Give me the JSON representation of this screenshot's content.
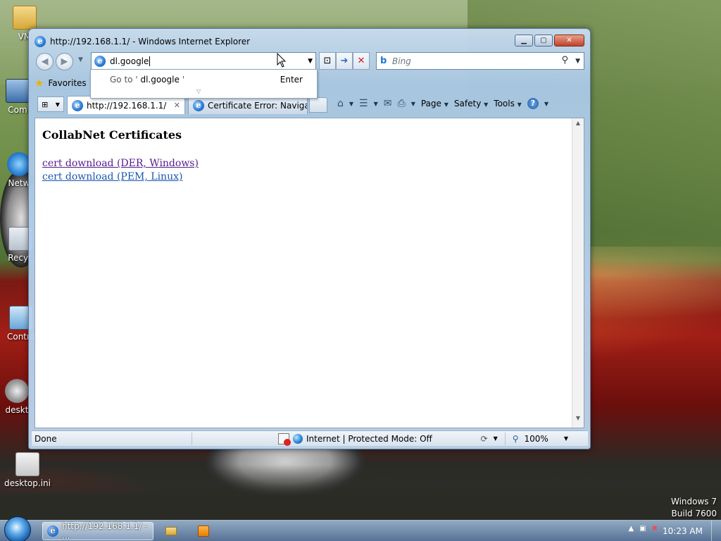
{
  "desktop": {
    "icons": [
      {
        "label": "VM",
        "icon": "folder-icon"
      },
      {
        "label": "Com",
        "icon": "computer-icon"
      },
      {
        "label": "Netw",
        "icon": "network-icon"
      },
      {
        "label": "Recyc",
        "icon": "recycle-bin-icon"
      },
      {
        "label": "Contro",
        "icon": "control-panel-icon"
      },
      {
        "label": "deskt",
        "icon": "settings-file-icon"
      },
      {
        "label": "desktop.ini",
        "icon": "settings-file-icon"
      }
    ],
    "watermark": {
      "line1": "Windows 7",
      "line2": "Build 7600"
    }
  },
  "window": {
    "title": "http://192.168.1.1/ - Windows Internet Explorer",
    "address_value": "dl.google",
    "search_placeholder": "Bing",
    "autocomplete": {
      "goto_prefix": "Go to '",
      "goto_value": "dl.google",
      "goto_suffix": "'",
      "enter_label": "Enter"
    },
    "favorites_label": "Favorites",
    "tabs": [
      {
        "label": "http://192.168.1.1/",
        "active": true
      },
      {
        "label": "Certificate Error: Navigati...",
        "active": false
      }
    ],
    "command_bar": {
      "page": "Page",
      "safety": "Safety",
      "tools": "Tools"
    },
    "page": {
      "heading": "CollabNet Certificates",
      "links": [
        {
          "text": "cert download (DER, Windows)",
          "color": "#551a8b"
        },
        {
          "text": "cert download (PEM, Linux)",
          "color": "#1a56b0"
        }
      ]
    },
    "status": {
      "text": "Done",
      "zone": "Internet | Protected Mode: Off",
      "zoom": "100%"
    }
  },
  "taskbar": {
    "active_item": "http://192.168.1.1/ - ...",
    "clock": "10:23 AM"
  },
  "colors": {
    "visited_link": "#551a8b",
    "link": "#1a56b0",
    "accent": "#2f7ed8"
  }
}
